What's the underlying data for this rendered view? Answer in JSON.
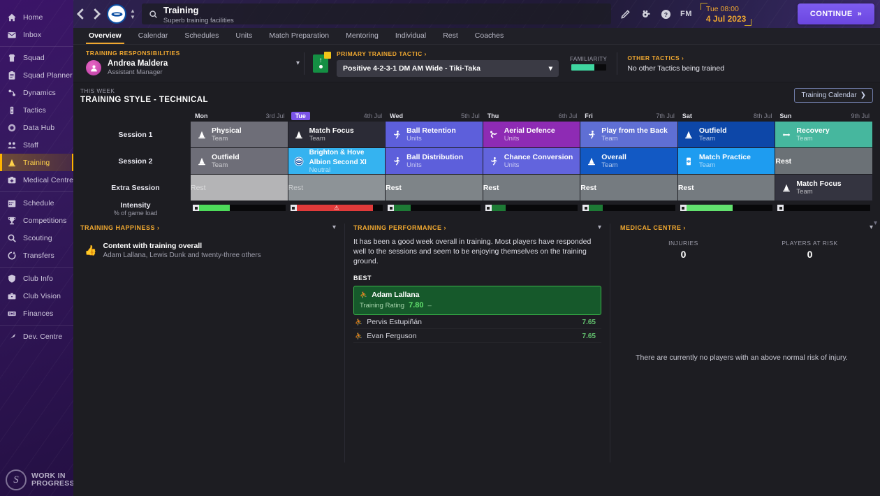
{
  "sidebar": {
    "items": [
      {
        "label": "Home",
        "icon": "home-icon"
      },
      {
        "label": "Inbox",
        "icon": "inbox-icon"
      },
      {
        "label": "Squad",
        "icon": "shirt-icon",
        "sep": true
      },
      {
        "label": "Squad Planner",
        "icon": "clipboard-icon"
      },
      {
        "label": "Dynamics",
        "icon": "dynamics-icon"
      },
      {
        "label": "Tactics",
        "icon": "tactics-icon"
      },
      {
        "label": "Data Hub",
        "icon": "datahub-icon"
      },
      {
        "label": "Staff",
        "icon": "staff-icon"
      },
      {
        "label": "Training",
        "icon": "cone-icon",
        "active": true
      },
      {
        "label": "Medical Centre",
        "icon": "medical-icon"
      },
      {
        "label": "Schedule",
        "icon": "calendar-icon",
        "sep": true
      },
      {
        "label": "Competitions",
        "icon": "trophy-icon"
      },
      {
        "label": "Scouting",
        "icon": "search-icon"
      },
      {
        "label": "Transfers",
        "icon": "transfer-icon"
      },
      {
        "label": "Club Info",
        "icon": "shield-icon",
        "sep": true
      },
      {
        "label": "Club Vision",
        "icon": "vision-icon"
      },
      {
        "label": "Finances",
        "icon": "finances-icon"
      },
      {
        "label": "Dev. Centre",
        "icon": "growth-icon",
        "sep": true
      }
    ],
    "footer": {
      "line1": "WORK IN",
      "line2": "PROGRESS"
    }
  },
  "topbar": {
    "back_icon": "chevron-left-icon",
    "forward_icon": "chevron-right-icon",
    "club_badge": "brighton-badge-icon",
    "search_icon": "search-icon",
    "title": "Training",
    "subtitle": "Superb training facilities",
    "icons": [
      "pencil-icon",
      "whistle-icon",
      "help-icon"
    ],
    "fm_label": "FM",
    "time": "Tue 08:00",
    "date": "4 Jul 2023",
    "continue_label": "CONTINUE",
    "continue_chevron": "»"
  },
  "tabs": [
    {
      "label": "Overview",
      "active": true
    },
    {
      "label": "Calendar"
    },
    {
      "label": "Schedules"
    },
    {
      "label": "Units"
    },
    {
      "label": "Match Preparation"
    },
    {
      "label": "Mentoring"
    },
    {
      "label": "Individual"
    },
    {
      "label": "Rest"
    },
    {
      "label": "Coaches"
    }
  ],
  "responsibilities": {
    "label": "TRAINING RESPONSIBILITIES",
    "name": "Andrea Maldera",
    "role": "Assistant Manager",
    "dropdown_icon": "chevron-down-icon"
  },
  "primary_tactic": {
    "label": "PRIMARY TRAINED TACTIC ›",
    "value": "Positive 4-2-3-1 DM AM Wide - Tiki-Taka",
    "familiarity_label": "FAMILIARITY",
    "familiarity_pct": 60
  },
  "other_tactics": {
    "label": "OTHER TACTICS ›",
    "value": "No other Tactics being trained"
  },
  "week": {
    "eyebrow": "THIS WEEK",
    "title": "TRAINING STYLE - TECHNICAL",
    "calendar_button": "Training Calendar",
    "row_labels": [
      {
        "main": "Session 1",
        "sub": ""
      },
      {
        "main": "Session 2",
        "sub": ""
      },
      {
        "main": "Extra Session",
        "sub": ""
      },
      {
        "main": "Intensity",
        "sub": "% of game load"
      }
    ],
    "days": [
      {
        "name": "Mon",
        "date": "3rd Jul",
        "today": false
      },
      {
        "name": "Tue",
        "date": "4th Jul",
        "today": true
      },
      {
        "name": "Wed",
        "date": "5th Jul",
        "today": false
      },
      {
        "name": "Thu",
        "date": "6th Jul",
        "today": false
      },
      {
        "name": "Fri",
        "date": "7th Jul",
        "today": false
      },
      {
        "name": "Sat",
        "date": "8th Jul",
        "today": false
      },
      {
        "name": "Sun",
        "date": "9th Jul",
        "today": false
      }
    ],
    "session1": [
      {
        "name": "Physical",
        "unit": "Team",
        "color": "#6e6e78",
        "icon": "cone-icon"
      },
      {
        "name": "Match Focus",
        "unit": "Team",
        "color": "#2b2b36",
        "icon": "cone-icon"
      },
      {
        "name": "Ball Retention",
        "unit": "Units",
        "color": "#5d5fdb",
        "icon": "player-icon"
      },
      {
        "name": "Aerial Defence",
        "unit": "Units",
        "color": "#8e2bb4",
        "icon": "header-icon"
      },
      {
        "name": "Play from the Back",
        "unit": "Team",
        "color": "#5f6fd4",
        "icon": "player-icon"
      },
      {
        "name": "Outfield",
        "unit": "Team",
        "color": "#0d47a8",
        "icon": "cone-icon"
      },
      {
        "name": "Recovery",
        "unit": "Team",
        "color": "#46b79e",
        "icon": "recovery-icon"
      }
    ],
    "session2": [
      {
        "name": "Outfield",
        "unit": "Team",
        "color": "#6e6e78",
        "icon": "cone-icon"
      },
      {
        "name": "Brighton & Hove Albion Second XI",
        "unit": "Neutral",
        "color": "#35b3f0",
        "icon": "brighton-badge-icon",
        "two_line": true
      },
      {
        "name": "Ball Distribution",
        "unit": "Units",
        "color": "#5d5fdb",
        "icon": "player-icon"
      },
      {
        "name": "Chance Conversion",
        "unit": "Units",
        "color": "#6264dd",
        "icon": "player-icon"
      },
      {
        "name": "Overall",
        "unit": "Team",
        "color": "#1259c4",
        "icon": "cone-icon"
      },
      {
        "name": "Match Practice",
        "unit": "Team",
        "color": "#1e9cf0",
        "icon": "pitch-icon"
      },
      {
        "name": "Rest",
        "unit": "",
        "color": "#6b7176",
        "rest": true
      }
    ],
    "extra": [
      {
        "name": "Rest",
        "unit": "",
        "color": "#b4b4b6",
        "rest": true,
        "dim": true
      },
      {
        "name": "Rest",
        "unit": "",
        "color": "#8d9397",
        "rest": true,
        "dim": true
      },
      {
        "name": "Rest",
        "unit": "",
        "color": "#7e8488",
        "rest": true
      },
      {
        "name": "Rest",
        "unit": "",
        "color": "#757b80",
        "rest": true
      },
      {
        "name": "Rest",
        "unit": "",
        "color": "#757b80",
        "rest": true
      },
      {
        "name": "Rest",
        "unit": "",
        "color": "#757b80",
        "rest": true
      },
      {
        "name": "Match Focus",
        "unit": "Team",
        "color": "#343440",
        "icon": "cone-icon"
      }
    ],
    "intensity": [
      {
        "pct": 40,
        "color": "#4ddb5a",
        "warn": false
      },
      {
        "pct": 89,
        "color": "#e03a3a",
        "warn": true
      },
      {
        "pct": 25,
        "color": "#1d7a35",
        "warn": false
      },
      {
        "pct": 22,
        "color": "#1d7a35",
        "warn": false
      },
      {
        "pct": 22,
        "color": "#1d7a35",
        "warn": false
      },
      {
        "pct": 57,
        "color": "#62e06e",
        "warn": false
      },
      {
        "pct": 3,
        "color": "#1c57c8",
        "warn": false
      }
    ]
  },
  "training_happiness": {
    "title": "TRAINING HAPPINESS ›",
    "thumb_icon": "thumbs-up-icon",
    "headline": "Content with training overall",
    "detail": "Adam Lallana, Lewis Dunk and twenty-three others",
    "chevron_icon": "chevron-down-icon"
  },
  "training_performance": {
    "title": "TRAINING PERFORMANCE ›",
    "summary": "It has been a good week overall in training. Most players have responded well to the sessions and seem to be enjoying themselves on the training ground.",
    "best_label": "BEST",
    "best": {
      "name": "Adam Lallana",
      "rating_label": "Training Rating",
      "rating": "7.80",
      "trend": "–",
      "position_icon": "player-icon"
    },
    "others": [
      {
        "name": "Pervis Estupiñán",
        "rating": "7.65"
      },
      {
        "name": "Evan Ferguson",
        "rating": "7.65"
      }
    ],
    "chevron_icon": "chevron-down-icon"
  },
  "medical_centre": {
    "title": "MEDICAL CENTRE ›",
    "stats": [
      {
        "label": "INJURIES",
        "value": "0"
      },
      {
        "label": "PLAYERS AT RISK",
        "value": "0"
      }
    ],
    "note": "There are currently no players with an above normal risk of injury.",
    "chevron_icon": "chevron-down-icon"
  }
}
